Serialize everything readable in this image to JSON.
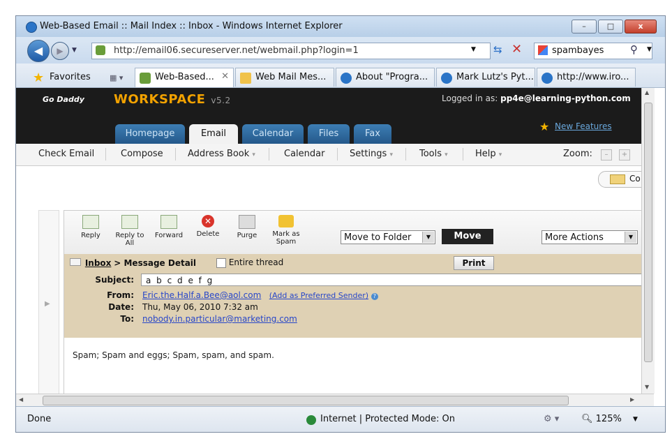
{
  "window": {
    "title": "Web-Based Email :: Mail Index :: Inbox - Windows Internet Explorer",
    "minimize": "–",
    "maximize": "□",
    "close": "x"
  },
  "address": {
    "url": "http://email06.secureserver.net/webmail.php?login=1",
    "search_value": "spambayes"
  },
  "tabs": {
    "favorites": "Favorites",
    "items": [
      {
        "label": "Web-Based..."
      },
      {
        "label": "Web Mail Mes..."
      },
      {
        "label": "About \"Progra..."
      },
      {
        "label": "Mark Lutz's Pyt..."
      },
      {
        "label": "http://www.iro..."
      }
    ]
  },
  "workspace": {
    "logo": "Go Daddy",
    "name": "WORKSPACE",
    "version": "v5.2",
    "logged_in_label": "Logged in as:",
    "logged_in_user": "pp4e@learning-python.com",
    "new_features": "New Features",
    "tabs": [
      "Homepage",
      "Email",
      "Calendar",
      "Files",
      "Fax"
    ]
  },
  "menu": {
    "items": [
      "Check Email",
      "Compose",
      "Address Book",
      "Calendar",
      "Settings",
      "Tools",
      "Help"
    ],
    "zoom": "Zoom:",
    "co_label": "Co"
  },
  "actions": {
    "items": [
      "Reply",
      "Reply to All",
      "Forward",
      "Delete",
      "Purge",
      "Mark as Spam"
    ],
    "move_to_folder": "Move to Folder",
    "move": "Move",
    "more_actions": "More Actions"
  },
  "message": {
    "breadcrumb_inbox": "Inbox",
    "breadcrumb_rest": "> Message Detail",
    "entire_thread": "Entire thread",
    "print": "Print",
    "subject_label": "Subject:",
    "subject": "a b c d e f g",
    "from_label": "From:",
    "from": "Eric.the.Half.a.Bee@aol.com",
    "preferred": "(Add as Preferred Sender)",
    "date_label": "Date:",
    "date": "Thu, May 06, 2010 7:32 am",
    "to_label": "To:",
    "to": "nobody.in.particular@marketing.com",
    "body": "Spam; Spam and eggs; Spam, spam, and spam."
  },
  "status": {
    "left": "Done",
    "zone": "Internet | Protected Mode: On",
    "zoom": "125%"
  }
}
